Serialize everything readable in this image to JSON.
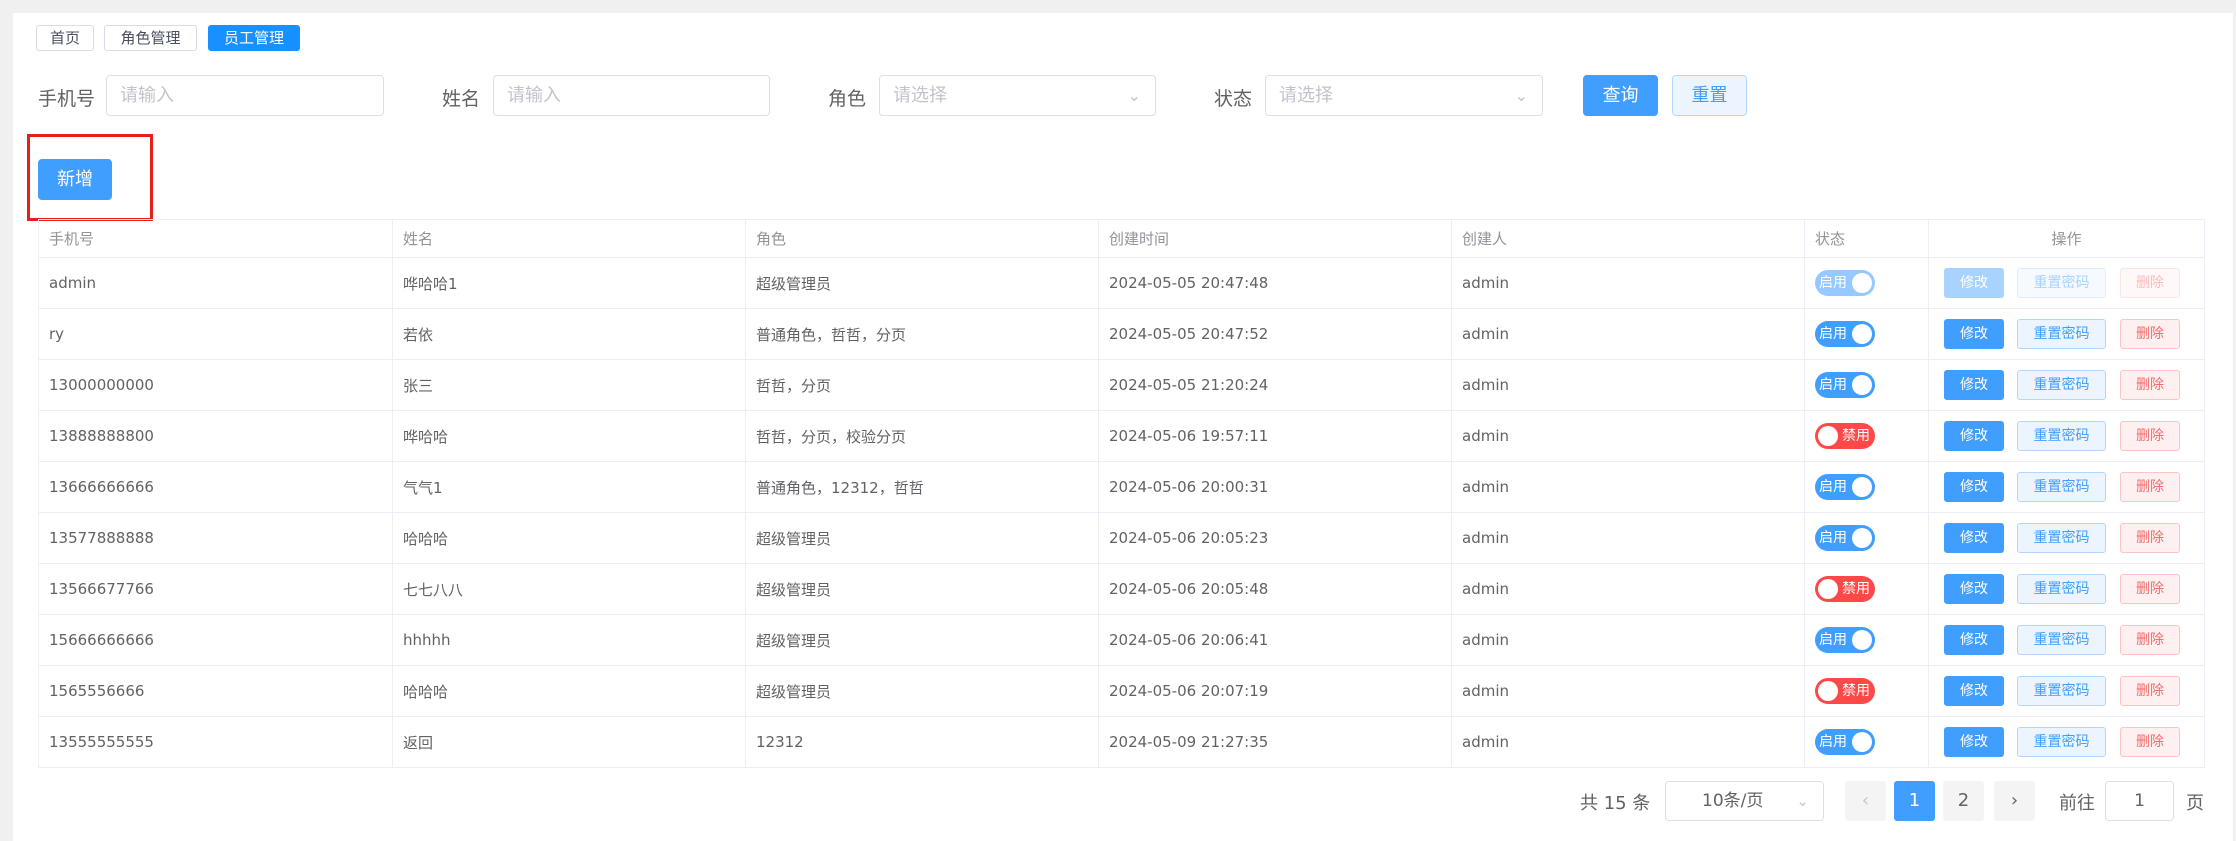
{
  "tags": [
    {
      "label": "首页",
      "active": false
    },
    {
      "label": "角色管理",
      "active": false
    },
    {
      "label": "员工管理",
      "active": true
    }
  ],
  "search": {
    "phone_label": "手机号",
    "phone_placeholder": "请输入",
    "name_label": "姓名",
    "name_placeholder": "请输入",
    "role_label": "角色",
    "role_placeholder": "请选择",
    "status_label": "状态",
    "status_placeholder": "请选择",
    "query_label": "查询",
    "reset_label": "重置"
  },
  "add_label": "新增",
  "table": {
    "columns": [
      "手机号",
      "姓名",
      "角色",
      "创建时间",
      "创建人",
      "状态",
      "操作"
    ],
    "actions": {
      "edit": "修改",
      "reset_pwd": "重置密码",
      "delete": "删除"
    },
    "rows": [
      {
        "phone": "admin",
        "name": "哗哈哈1",
        "role": "超级管理员",
        "created": "2024-05-05 20:47:48",
        "creator": "admin",
        "status": "启用",
        "disabled": true
      },
      {
        "phone": "ry",
        "name": "若依",
        "role": "普通角色，哲哲，分页",
        "created": "2024-05-05 20:47:52",
        "creator": "admin",
        "status": "启用",
        "disabled": false
      },
      {
        "phone": "13000000000",
        "name": "张三",
        "role": "哲哲，分页",
        "created": "2024-05-05 21:20:24",
        "creator": "admin",
        "status": "启用",
        "disabled": false
      },
      {
        "phone": "13888888800",
        "name": "哗哈哈",
        "role": "哲哲，分页，校验分页",
        "created": "2024-05-06 19:57:11",
        "creator": "admin",
        "status": "禁用",
        "disabled": false
      },
      {
        "phone": "13666666666",
        "name": "气气1",
        "role": "普通角色，12312，哲哲",
        "created": "2024-05-06 20:00:31",
        "creator": "admin",
        "status": "启用",
        "disabled": false
      },
      {
        "phone": "13577888888",
        "name": "哈哈哈",
        "role": "超级管理员",
        "created": "2024-05-06 20:05:23",
        "creator": "admin",
        "status": "启用",
        "disabled": false
      },
      {
        "phone": "13566677766",
        "name": "七七八八",
        "role": "超级管理员",
        "created": "2024-05-06 20:05:48",
        "creator": "admin",
        "status": "禁用",
        "disabled": false
      },
      {
        "phone": "15666666666",
        "name": "hhhhh",
        "role": "超级管理员",
        "created": "2024-05-06 20:06:41",
        "creator": "admin",
        "status": "启用",
        "disabled": false
      },
      {
        "phone": "1565556666",
        "name": "哈哈哈",
        "role": "超级管理员",
        "created": "2024-05-06 20:07:19",
        "creator": "admin",
        "status": "禁用",
        "disabled": false
      },
      {
        "phone": "13555555555",
        "name": "返回",
        "role": "12312",
        "created": "2024-05-09 21:27:35",
        "creator": "admin",
        "status": "启用",
        "disabled": false
      }
    ]
  },
  "pagination": {
    "total_text": "共 15 条",
    "page_size": "10条/页",
    "prev_icon": "chevron-left-icon",
    "next_icon": "chevron-right-icon",
    "pages": [
      "1",
      "2"
    ],
    "current": "1",
    "goto_label": "前往",
    "goto_value": "1",
    "page_suffix": "页"
  },
  "colors": {
    "primary": "#409eff",
    "danger": "#ff4949",
    "tag_active": "#1890ff",
    "highlight_box": "#e5201b"
  }
}
